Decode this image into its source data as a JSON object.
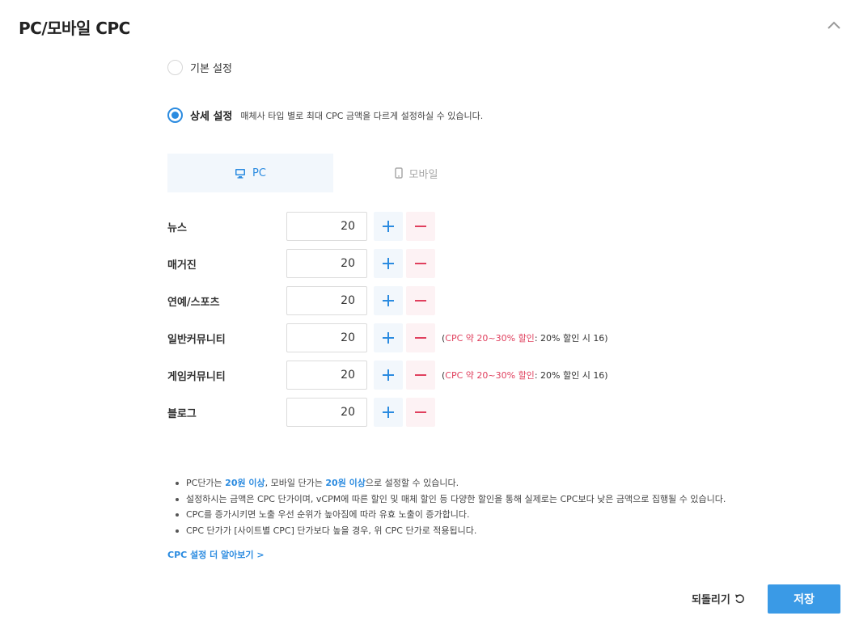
{
  "section": {
    "title": "PC/모바일 CPC",
    "collapse_icon": "chevron-up-icon"
  },
  "settings": {
    "basic_label": "기본 설정",
    "basic_selected": false,
    "detail_label": "상세 설정",
    "detail_selected": true,
    "detail_desc": "매체사 타입 별로 최대 CPC 금액을 다르게 설정하실 수 있습니다."
  },
  "tabs": [
    {
      "label": "PC",
      "icon": "monitor-icon",
      "active": true
    },
    {
      "label": "모바일",
      "icon": "mobile-phone-icon",
      "active": false
    }
  ],
  "rows": [
    {
      "label": "뉴스",
      "value": "20",
      "note": null
    },
    {
      "label": "매거진",
      "value": "20",
      "note": null
    },
    {
      "label": "연예/스포츠",
      "value": "20",
      "note": null
    },
    {
      "label": "일반커뮤니티",
      "value": "20",
      "note": {
        "open": "(",
        "red": "CPC 약 20~30% 할인",
        "rest": ": 20% 할인 시 16)"
      }
    },
    {
      "label": "게임커뮤니티",
      "value": "20",
      "note": {
        "open": "(",
        "red": "CPC 약 20~30% 할인",
        "rest": ": 20% 할인 시 16)"
      }
    },
    {
      "label": "블로그",
      "value": "20",
      "note": null
    }
  ],
  "notes": {
    "n1": {
      "a": "PC단가는 ",
      "b": "20원 이상",
      "c": ", 모바일 단가는 ",
      "d": "20원 이상",
      "e": "으로 설정할 수 있습니다."
    },
    "n2": "설정하시는 금액은 CPC 단가이며, vCPM에 따른 할인 및 매체 할인 등 다양한 할인을 통해 실제로는 CPC보다 낮은 금액으로 집행될 수 있습니다.",
    "n3": "CPC를 증가시키면 노출 우선 순위가 높아짐에 따라 유효 노출이 증가합니다.",
    "n4": "CPC 단가가 [사이트별 CPC] 단가보다 높을 경우, 위 CPC 단가로 적용됩니다."
  },
  "learn_more": "CPC 설정 더 알아보기 >",
  "footer": {
    "reset_label": "되돌리기",
    "reset_icon": "undo-icon",
    "save_label": "저장"
  },
  "colors": {
    "accent": "#2b8be0",
    "danger": "#e0405e",
    "save_bg": "#3a9ae6"
  }
}
